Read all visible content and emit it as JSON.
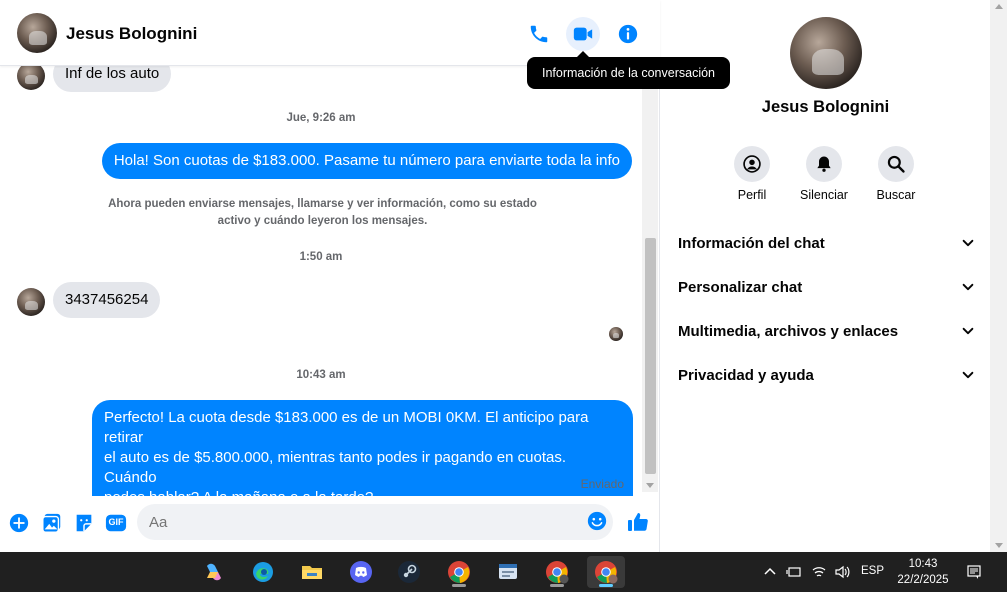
{
  "header": {
    "contact_name": "Jesus Bolognini",
    "phone_icon": "phone-icon",
    "video_icon": "video-camera-icon",
    "info_icon": "info-icon",
    "tooltip": "Información de la conversación"
  },
  "messages": {
    "partial_in": "Inf de los auto",
    "ts1": "Jue, 9:26 am",
    "out1": "Hola! Son cuotas de $183.000. Pasame tu número para enviarte toda la info",
    "system_line1": "Ahora pueden enviarse mensajes, llamarse y ver información, como su estado",
    "system_line2": "activo y cuándo leyeron los mensajes.",
    "ts2": "1:50 am",
    "in1": "3437456254",
    "ts3": "10:43 am",
    "out2_line1": "Perfecto! La cuota desde $183.000 es de un MOBI 0KM. El anticipo para retirar",
    "out2_line2": "el auto es de $5.800.000, mientras tanto podes ir pagando en cuotas. Cuándo",
    "out2_line3": "podes hablar? A la mañana o a la tarde?",
    "status": "Enviado"
  },
  "composer": {
    "placeholder": "Aa",
    "icons": [
      "plus-circle-icon",
      "image-icon",
      "sticker-icon",
      "gif-icon",
      "emoji-icon",
      "thumbs-up-icon"
    ],
    "gif_label": "GIF"
  },
  "panel": {
    "name": "Jesus Bolognini",
    "actions": [
      {
        "label": "Perfil",
        "icon": "profile-icon"
      },
      {
        "label": "Silenciar",
        "icon": "bell-icon"
      },
      {
        "label": "Buscar",
        "icon": "search-icon"
      }
    ],
    "sections": [
      "Información del chat",
      "Personalizar chat",
      "Multimedia, archivos y enlaces",
      "Privacidad y ayuda"
    ]
  },
  "taskbar": {
    "apps": [
      "copilot-icon",
      "edge-icon",
      "file-explorer-icon",
      "discord-icon",
      "steam-icon",
      "chrome-icon",
      "news-app-icon",
      "chrome-profile-c-icon",
      "chrome-profile-active-icon"
    ],
    "language": "ESP",
    "time": "10:43",
    "date": "22/2/2025"
  },
  "colors": {
    "accent": "#0084ff",
    "incoming_bubble": "#e4e6eb",
    "taskbar": "#202020"
  }
}
